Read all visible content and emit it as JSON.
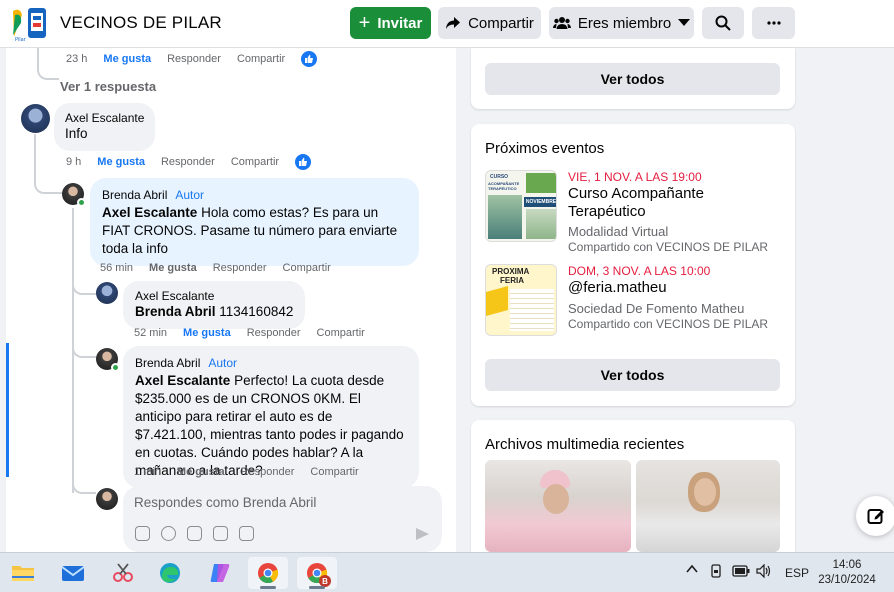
{
  "header": {
    "group_name": "VECINOS DE PILAR",
    "invite_label": "Invitar",
    "share_label": "Compartir",
    "member_label": "Eres miembro"
  },
  "comments": {
    "top_actions": {
      "time": "23 h",
      "like": "Me gusta",
      "reply": "Responder",
      "share": "Compartir"
    },
    "view_replies": "Ver 1 respuesta",
    "c1": {
      "author": "Axel Escalante",
      "text": "Info",
      "time": "9 h",
      "like": "Me gusta",
      "reply": "Responder",
      "share": "Compartir"
    },
    "c2": {
      "author": "Brenda Abril",
      "badge": "Autor",
      "mention": "Axel Escalante",
      "text": " Hola como estas? Es para un FIAT CRONOS. Pasame tu número para enviarte toda la info",
      "time": "56 min",
      "like": "Me gusta",
      "reply": "Responder",
      "share": "Compartir"
    },
    "c3": {
      "author": "Axel Escalante",
      "mention": "Brenda Abril",
      "text": " 1134160842",
      "time": "52 min",
      "like": "Me gusta",
      "reply": "Responder",
      "share": "Compartir"
    },
    "c4": {
      "author": "Brenda Abril",
      "badge": "Autor",
      "mention": "Axel Escalante",
      "text": " Perfecto! La cuota desde $235.000 es de un CRONOS 0KM. El anticipo para retirar el auto es de $7.421.100, mientras tanto podes ir pagando en cuotas. Cuándo podes hablar? A la mañana o a la tarde?",
      "time": "1 min",
      "like": "Me gusta",
      "reply": "Responder",
      "share": "Compartir"
    },
    "reply_placeholder": "Respondes como Brenda Abril"
  },
  "sidebar": {
    "see_all_top": "Ver todos",
    "events_title": "Próximos eventos",
    "events": [
      {
        "date": "VIE, 1 NOV. A LAS 19:00",
        "title": "Curso Acompañante Terapéutico",
        "sub": "Modalidad Virtual",
        "shared": "Compartido con VECINOS DE PILAR",
        "thumb": {
          "l1": "CURSO",
          "l2": "ACOMPAÑANTE TERAPÉUTICO",
          "l3": "NOVIEMBRE"
        }
      },
      {
        "date": "DOM, 3 NOV. A LAS 10:00",
        "title": "@feria.matheu",
        "sub": "Sociedad De Fomento Matheu",
        "shared": "Compartido con VECINOS DE PILAR",
        "thumb": {
          "l1": "PROXIMA",
          "l2": "FERIA"
        }
      }
    ],
    "see_all_events": "Ver todos",
    "media_title": "Archivos multimedia recientes"
  },
  "taskbar": {
    "lang": "ESP",
    "time": "14:06",
    "date": "23/10/2024",
    "badge": "B"
  },
  "colors": {
    "invite": "#1b8e3a",
    "accent": "#1877f2",
    "event_date": "#e41e3f"
  }
}
